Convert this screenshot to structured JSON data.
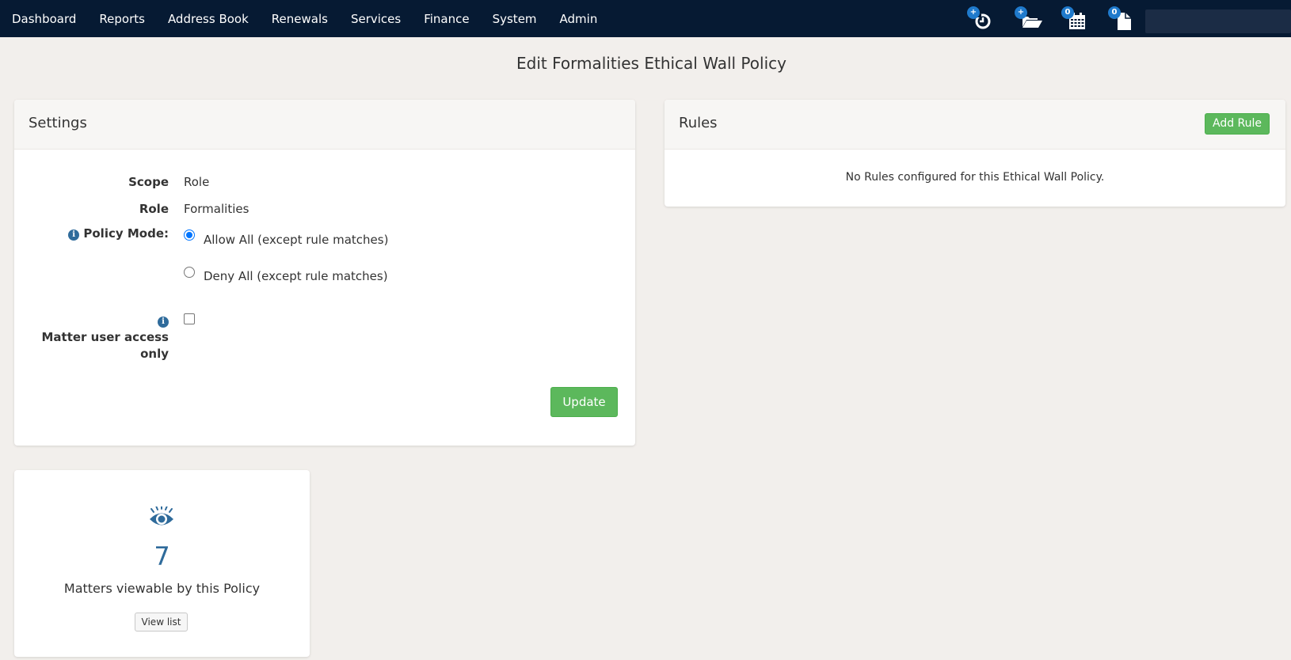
{
  "nav": {
    "items": [
      {
        "label": "Dashboard"
      },
      {
        "label": "Reports"
      },
      {
        "label": "Address Book"
      },
      {
        "label": "Renewals"
      },
      {
        "label": "Services"
      },
      {
        "label": "Finance"
      },
      {
        "label": "System"
      },
      {
        "label": "Admin"
      }
    ],
    "icons": [
      {
        "name": "history-icon",
        "badge": "+"
      },
      {
        "name": "open-folder-icon",
        "badge": "+"
      },
      {
        "name": "calendar-icon",
        "badge": "0"
      },
      {
        "name": "document-icon",
        "badge": "0"
      }
    ],
    "user_box_color": "#1b2c45"
  },
  "page": {
    "title": "Edit Formalities Ethical Wall Policy"
  },
  "settings": {
    "title": "Settings",
    "scope_label": "Scope",
    "scope_value": "Role",
    "role_label": "Role",
    "role_value": "Formalities",
    "policy_mode_label": "Policy Mode:",
    "policy_mode_options": [
      {
        "label": "Allow All (except rule matches)",
        "checked": true
      },
      {
        "label": "Deny All (except rule matches)",
        "checked": false
      }
    ],
    "matter_access_label": "Matter user access only",
    "matter_access_checked": false,
    "update_label": "Update"
  },
  "rules": {
    "title": "Rules",
    "add_label": "Add Rule",
    "empty_text": "No Rules configured for this Ethical Wall Policy."
  },
  "matters": {
    "icon": "eye-icon",
    "count": "7",
    "label": "Matters viewable by this Policy",
    "view_list_label": "View list"
  },
  "colors": {
    "navbar": "#061a33",
    "background": "#f2efec",
    "accent_green": "#5cb85c",
    "accent_blue": "#2f6b9b",
    "badge_blue": "#1f7acc"
  }
}
